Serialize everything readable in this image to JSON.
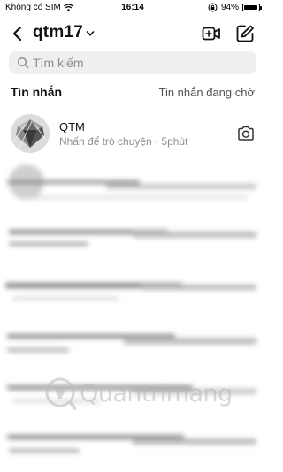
{
  "status_bar": {
    "carrier": "Không có SIM",
    "time": "16:14",
    "battery": "94%",
    "battery_level": 0.94
  },
  "header": {
    "account_name": "qtm17"
  },
  "search": {
    "placeholder": "Tìm kiếm"
  },
  "messages": {
    "section_title": "Tin nhắn",
    "requests_label": "Tin nhắn đang chờ",
    "conversations": [
      {
        "name": "QTM",
        "subtitle": "Nhấn để trò chuyện · 5phút"
      }
    ]
  },
  "watermark": {
    "text": "Quantrimang"
  },
  "icons": {
    "back": "chevron-left-icon",
    "dropdown": "chevron-down-icon",
    "video": "video-plus-icon",
    "compose": "compose-icon",
    "search": "search-icon",
    "camera": "camera-icon",
    "wifi": "wifi-icon",
    "rotation_lock": "rotation-lock-icon",
    "battery": "battery-icon"
  }
}
